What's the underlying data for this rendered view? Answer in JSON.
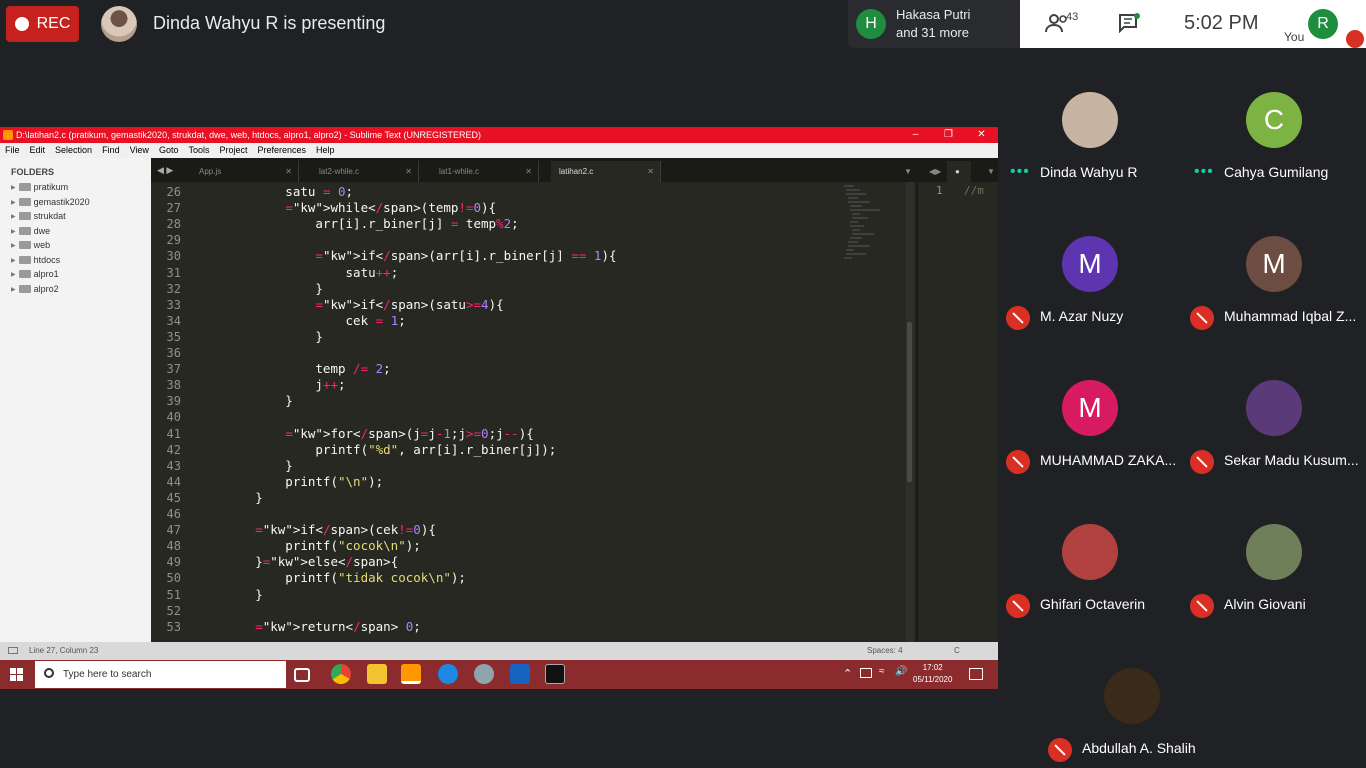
{
  "meet": {
    "rec_label": "REC",
    "presenting_text": "Dinda Wahyu R is presenting",
    "others": {
      "initial": "H",
      "line1": "Hakasa Putri",
      "line2": "and 31 more"
    },
    "people_count": "43",
    "clock": "5:02 PM",
    "you_label": "You",
    "you_initial": "R"
  },
  "sublime": {
    "title": "D:\\latihan2.c (pratikum, gemastik2020, strukdat, dwe, web, htdocs, alpro1, alpro2) - Sublime Text (UNREGISTERED)",
    "menu": [
      "File",
      "Edit",
      "Selection",
      "Find",
      "View",
      "Goto",
      "Tools",
      "Project",
      "Preferences",
      "Help"
    ],
    "folders_title": "FOLDERS",
    "folders": [
      "pratikum",
      "gemastik2020",
      "strukdat",
      "dwe",
      "web",
      "htdocs",
      "alpro1",
      "alpro2"
    ],
    "tabs": [
      "App.js",
      "lat2-while.c",
      "lat1-while.c",
      "latihan2.c"
    ],
    "right_pane": {
      "line": "1",
      "text": "//m"
    },
    "status_left": "Line 27, Column 23",
    "status_spaces": "Spaces: 4",
    "status_syntax": "C"
  },
  "code_lines": [
    {
      "n": "26",
      "t": "            satu = 0;"
    },
    {
      "n": "27",
      "t": "            while(temp!=0){"
    },
    {
      "n": "28",
      "t": "                arr[i].r_biner[j] = temp%2;"
    },
    {
      "n": "29",
      "t": ""
    },
    {
      "n": "30",
      "t": "                if(arr[i].r_biner[j] == 1){"
    },
    {
      "n": "31",
      "t": "                    satu++;"
    },
    {
      "n": "32",
      "t": "                }"
    },
    {
      "n": "33",
      "t": "                if(satu>=4){"
    },
    {
      "n": "34",
      "t": "                    cek = 1;"
    },
    {
      "n": "35",
      "t": "                }"
    },
    {
      "n": "36",
      "t": ""
    },
    {
      "n": "37",
      "t": "                temp /= 2;"
    },
    {
      "n": "38",
      "t": "                j++;"
    },
    {
      "n": "39",
      "t": "            }"
    },
    {
      "n": "40",
      "t": ""
    },
    {
      "n": "41",
      "t": "            for(j=j-1;j>=0;j--){"
    },
    {
      "n": "42",
      "t": "                printf(\"%d\", arr[i].r_biner[j]);"
    },
    {
      "n": "43",
      "t": "            }"
    },
    {
      "n": "44",
      "t": "            printf(\"\\n\");"
    },
    {
      "n": "45",
      "t": "        }"
    },
    {
      "n": "46",
      "t": ""
    },
    {
      "n": "47",
      "t": "        if(cek!=0){"
    },
    {
      "n": "48",
      "t": "            printf(\"cocok\\n\");"
    },
    {
      "n": "49",
      "t": "        }else{"
    },
    {
      "n": "50",
      "t": "            printf(\"tidak cocok\\n\");"
    },
    {
      "n": "51",
      "t": "        }"
    },
    {
      "n": "52",
      "t": ""
    },
    {
      "n": "53",
      "t": "        return 0;"
    }
  ],
  "taskbar": {
    "search_placeholder": "Type here to search",
    "time": "17:02",
    "date": "05/11/2020"
  },
  "participants": [
    {
      "name": "Dinda Wahyu R",
      "initial": "",
      "color": "#c8b4a2",
      "muted": false
    },
    {
      "name": "Cahya Gumilang",
      "initial": "C",
      "color": "#7cb342",
      "muted": false
    },
    {
      "name": "M. Azar Nuzy",
      "initial": "M",
      "color": "#5e35b1",
      "muted": true
    },
    {
      "name": "Muhammad Iqbal Z...",
      "initial": "M",
      "color": "#6d4c41",
      "muted": true
    },
    {
      "name": "MUHAMMAD ZAKA...",
      "initial": "M",
      "color": "#d81b60",
      "muted": true
    },
    {
      "name": "Sekar Madu Kusum...",
      "initial": "",
      "color": "#5a3a78",
      "muted": true
    },
    {
      "name": "Ghifari Octaverin",
      "initial": "",
      "color": "#b0413e",
      "muted": true
    },
    {
      "name": "Alvin Giovani",
      "initial": "",
      "color": "#6f7f5a",
      "muted": true
    },
    {
      "name": "Abdullah A. Shalih",
      "initial": "",
      "color": "#3a2a1a",
      "muted": true
    }
  ],
  "colors": {
    "rec": "#c5221f",
    "sublime_title": "#e81123",
    "taskbar": "#8b2b2d",
    "keyword": "#f92672",
    "number": "#ae81ff",
    "string": "#e6db74"
  }
}
